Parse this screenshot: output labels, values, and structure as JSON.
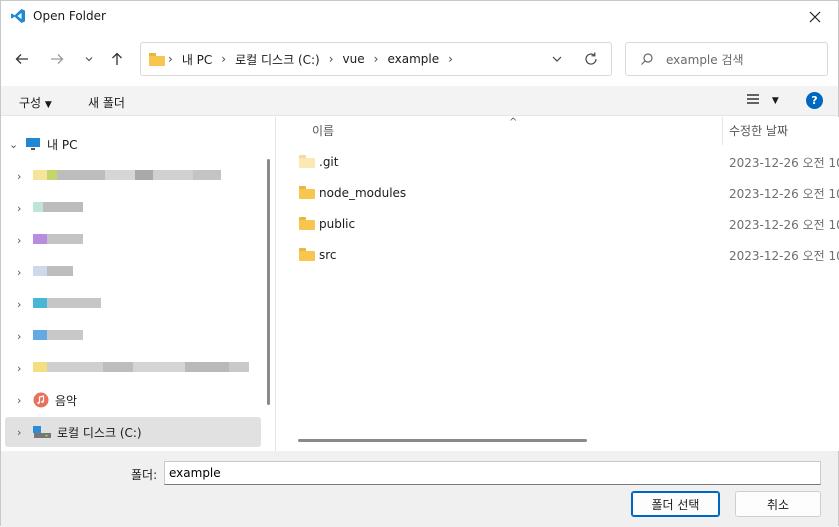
{
  "window": {
    "title": "Open Folder"
  },
  "address": {
    "crumbs": [
      "내 PC",
      "로컬 디스크 (C:)",
      "vue",
      "example"
    ]
  },
  "search": {
    "placeholder": "example 검색"
  },
  "commands": {
    "organize": "구성",
    "new_folder": "새 폴더"
  },
  "tree": {
    "root_label": "내 PC",
    "music_label": "음악",
    "local_disk_label": "로컬 디스크 (C:)"
  },
  "columns": {
    "name": "이름",
    "modified": "수정한 날짜"
  },
  "files": [
    {
      "name": ".git",
      "date": "2023-12-26 오전 10",
      "hidden": true
    },
    {
      "name": "node_modules",
      "date": "2023-12-26 오전 10",
      "hidden": false
    },
    {
      "name": "public",
      "date": "2023-12-26 오전 10",
      "hidden": false
    },
    {
      "name": "src",
      "date": "2023-12-26 오전 10",
      "hidden": false
    }
  ],
  "bottom": {
    "folder_label": "폴더:",
    "folder_value": "example",
    "select_button": "폴더 선택",
    "cancel_button": "취소"
  },
  "colors": {
    "accent": "#0067c0",
    "folder": "#f8c64f",
    "selected_row": "#e1e1e1"
  },
  "icons": [
    "vscode-icon",
    "close-icon",
    "back-arrow-icon",
    "forward-arrow-icon",
    "recent-dropdown-icon",
    "up-arrow-icon",
    "folder-icon",
    "chevron-down-icon",
    "refresh-icon",
    "search-icon",
    "view-list-icon",
    "help-icon",
    "pc-icon",
    "music-icon",
    "drive-icon"
  ]
}
